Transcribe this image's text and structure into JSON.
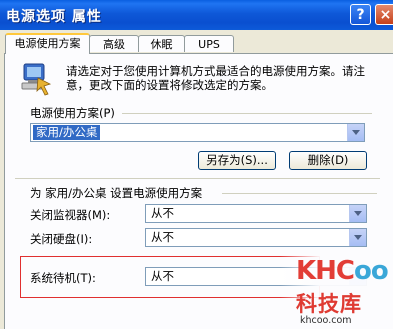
{
  "window": {
    "title": "电源选项 属性",
    "help_label": "?",
    "close_label": "×"
  },
  "tabs": [
    {
      "label": "电源使用方案"
    },
    {
      "label": "高级"
    },
    {
      "label": "休眠"
    },
    {
      "label": "UPS"
    }
  ],
  "intro": {
    "icon": "power-plan-icon",
    "text": "请选定对于您使用计算机方式最适合的电源使用方案。请注意，更改下面的设置将修改选定的方案。"
  },
  "scheme": {
    "group_label": "电源使用方案(P)",
    "selected": "家用/办公桌",
    "save_as_label": "另存为(S)...",
    "delete_label": "删除(D)"
  },
  "settings": {
    "group_label": "为 家用/办公桌 设置电源使用方案",
    "rows": [
      {
        "label": "关闭监视器(M):",
        "value": "从不"
      },
      {
        "label": "关闭硬盘(I):",
        "value": "从不"
      },
      {
        "label": "系统待机(T):",
        "value": "从不"
      }
    ]
  },
  "watermark": {
    "logo_left": "KHC",
    "logo_right": "oo",
    "name": "科技库",
    "url": "khcoo.com"
  }
}
